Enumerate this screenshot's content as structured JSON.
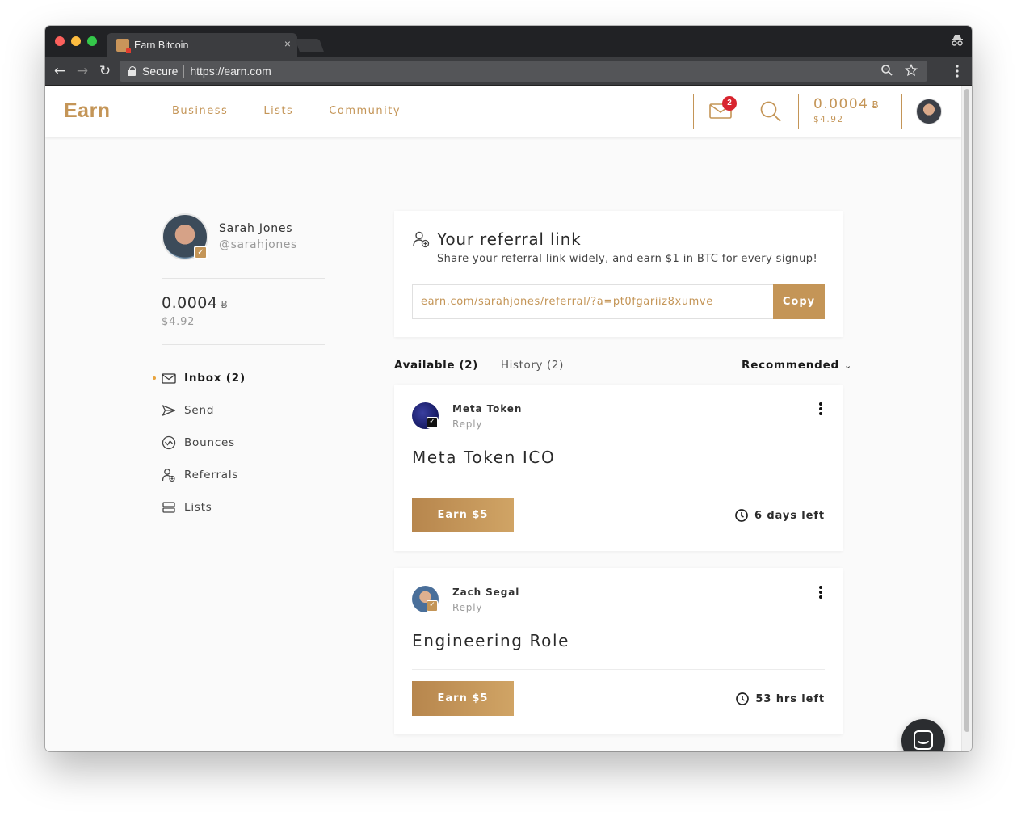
{
  "browser": {
    "tab_title": "Earn Bitcoin",
    "tab_close": "×",
    "secure_label": "Secure",
    "url": "https://earn.com"
  },
  "header": {
    "logo": "Earn",
    "nav": [
      "Business",
      "Lists",
      "Community"
    ],
    "mail_badge": "2",
    "balance_btc": "0.0004",
    "btc_symbol": "Ƀ",
    "balance_usd": "$4.92"
  },
  "profile": {
    "name": "Sarah Jones",
    "handle": "@sarahjones",
    "balance_btc": "0.0004",
    "btc_symbol": "Ƀ",
    "balance_usd": "$4.92"
  },
  "sidebar": {
    "items": [
      {
        "label": "Inbox (2)",
        "icon": "mail-icon",
        "active": true
      },
      {
        "label": "Send",
        "icon": "send-icon"
      },
      {
        "label": "Bounces",
        "icon": "bounces-icon"
      },
      {
        "label": "Referrals",
        "icon": "referrals-icon"
      },
      {
        "label": "Lists",
        "icon": "lists-icon"
      }
    ]
  },
  "referral": {
    "title": "Your referral link",
    "subtitle": "Share your referral link widely, and earn $1 in BTC for every signup!",
    "link": "earn.com/sarahjones/referral/?a=pt0fgariiz8xumve",
    "copy_label": "Copy"
  },
  "feed": {
    "tabs": [
      "Available (2)",
      "History (2)"
    ],
    "sort_label": "Recommended",
    "cards": [
      {
        "sender": "Meta Token",
        "reply_label": "Reply",
        "subject": "Meta Token ICO",
        "earn_label": "Earn $5",
        "time_left": "6 days left",
        "avatar_color": "#1b1f6b",
        "check_color": "#111111"
      },
      {
        "sender": "Zach Segal",
        "reply_label": "Reply",
        "subject": "Engineering Role",
        "earn_label": "Earn $5",
        "time_left": "53 hrs left",
        "avatar_color": "#4a6f9a",
        "check_color": "#c49557"
      }
    ]
  },
  "colors": {
    "accent": "#c49557",
    "badge": "#d8242e"
  }
}
